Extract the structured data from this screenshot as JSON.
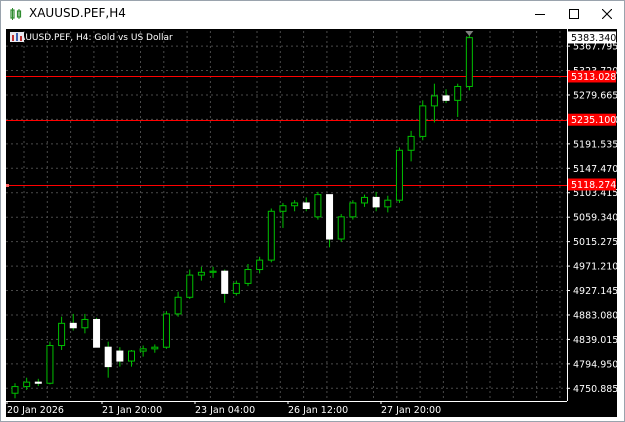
{
  "window": {
    "title": "XAUUSD.PEF,H4"
  },
  "chart_header": {
    "symbol_timeframe": "XAUUSD.PEF, H4:",
    "description": "Gold vs US Dollar"
  },
  "colors": {
    "background": "#000000",
    "grid": "#4a4a4a",
    "bull_candle": "#00c000",
    "bear_candle": "#ffffff",
    "horizontal_line": "#ff0000",
    "axis_text": "#ffffff"
  },
  "chart_data": {
    "type": "candlestick",
    "symbol": "XAUUSD.PEF",
    "timeframe": "H4",
    "ylim": [
      4728.0,
      5395.0
    ],
    "y_ticks": [
      "5367.795",
      "5323.720",
      "5279.665",
      "5235.590",
      "5191.535",
      "5147.470",
      "5103.415",
      "5059.340",
      "5015.275",
      "4971.210",
      "4927.145",
      "4883.080",
      "4839.015",
      "4794.950",
      "4750.885"
    ],
    "x_labels": [
      "20 Jan 2026",
      "21 Jan 20:00",
      "23 Jan 04:00",
      "26 Jan 12:00",
      "27 Jan 20:00"
    ],
    "price_labels": [
      {
        "text": "5383.340",
        "value": 5383.34,
        "style": "current"
      },
      {
        "text": "5313.028",
        "value": 5313.028,
        "style": "line"
      },
      {
        "text": "5235.100",
        "value": 5235.1,
        "style": "line"
      },
      {
        "text": "5118.274",
        "value": 5118.274,
        "style": "line"
      }
    ],
    "horizontal_lines": [
      5313.028,
      5235.1,
      5118.274
    ],
    "candles": [
      {
        "o": 4742,
        "h": 4760,
        "l": 4733,
        "c": 4754
      },
      {
        "o": 4754,
        "h": 4770,
        "l": 4748,
        "c": 4762
      },
      {
        "o": 4762,
        "h": 4768,
        "l": 4755,
        "c": 4760
      },
      {
        "o": 4760,
        "h": 4835,
        "l": 4758,
        "c": 4828
      },
      {
        "o": 4828,
        "h": 4880,
        "l": 4820,
        "c": 4868
      },
      {
        "o": 4868,
        "h": 4885,
        "l": 4855,
        "c": 4860
      },
      {
        "o": 4860,
        "h": 4885,
        "l": 4850,
        "c": 4875
      },
      {
        "o": 4875,
        "h": 4878,
        "l": 4825,
        "c": 4825
      },
      {
        "o": 4825,
        "h": 4835,
        "l": 4770,
        "c": 4790
      },
      {
        "o": 4818,
        "h": 4825,
        "l": 4790,
        "c": 4800
      },
      {
        "o": 4800,
        "h": 4820,
        "l": 4790,
        "c": 4818
      },
      {
        "o": 4818,
        "h": 4828,
        "l": 4808,
        "c": 4822
      },
      {
        "o": 4822,
        "h": 4830,
        "l": 4815,
        "c": 4825
      },
      {
        "o": 4825,
        "h": 4890,
        "l": 4822,
        "c": 4885
      },
      {
        "o": 4885,
        "h": 4925,
        "l": 4880,
        "c": 4915
      },
      {
        "o": 4915,
        "h": 4965,
        "l": 4912,
        "c": 4955
      },
      {
        "o": 4955,
        "h": 4970,
        "l": 4945,
        "c": 4960
      },
      {
        "o": 4960,
        "h": 4970,
        "l": 4950,
        "c": 4962
      },
      {
        "o": 4962,
        "h": 4965,
        "l": 4905,
        "c": 4922
      },
      {
        "o": 4922,
        "h": 4945,
        "l": 4918,
        "c": 4940
      },
      {
        "o": 4940,
        "h": 4975,
        "l": 4935,
        "c": 4965
      },
      {
        "o": 4965,
        "h": 4988,
        "l": 4958,
        "c": 4982
      },
      {
        "o": 4982,
        "h": 5075,
        "l": 4978,
        "c": 5070
      },
      {
        "o": 5070,
        "h": 5085,
        "l": 5040,
        "c": 5080
      },
      {
        "o": 5080,
        "h": 5090,
        "l": 5070,
        "c": 5085
      },
      {
        "o": 5085,
        "h": 5095,
        "l": 5070,
        "c": 5075
      },
      {
        "o": 5060,
        "h": 5105,
        "l": 5055,
        "c": 5100
      },
      {
        "o": 5100,
        "h": 5100,
        "l": 5005,
        "c": 5020
      },
      {
        "o": 5020,
        "h": 5065,
        "l": 5015,
        "c": 5060
      },
      {
        "o": 5060,
        "h": 5090,
        "l": 5055,
        "c": 5085
      },
      {
        "o": 5085,
        "h": 5100,
        "l": 5078,
        "c": 5095
      },
      {
        "o": 5095,
        "h": 5105,
        "l": 5070,
        "c": 5078
      },
      {
        "o": 5078,
        "h": 5098,
        "l": 5068,
        "c": 5090
      },
      {
        "o": 5090,
        "h": 5185,
        "l": 5085,
        "c": 5180
      },
      {
        "o": 5180,
        "h": 5215,
        "l": 5160,
        "c": 5205
      },
      {
        "o": 5205,
        "h": 5270,
        "l": 5198,
        "c": 5260
      },
      {
        "o": 5260,
        "h": 5300,
        "l": 5230,
        "c": 5278
      },
      {
        "o": 5278,
        "h": 5290,
        "l": 5265,
        "c": 5270
      },
      {
        "o": 5270,
        "h": 5300,
        "l": 5240,
        "c": 5295
      },
      {
        "o": 5295,
        "h": 5390,
        "l": 5288,
        "c": 5383
      }
    ]
  }
}
